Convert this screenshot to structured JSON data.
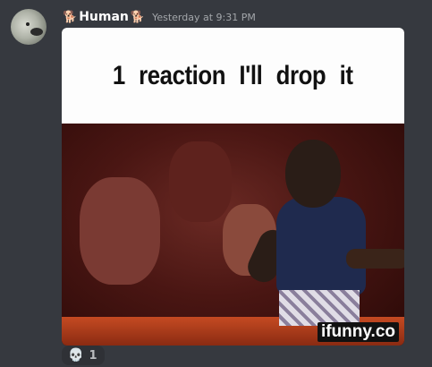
{
  "message": {
    "author": {
      "name": "Human",
      "name_prefix_emoji": "🐕",
      "name_suffix_emoji": "🐕",
      "avatar_icon": "sea-lion-avatar"
    },
    "timestamp": "Yesterday at 9:31 PM",
    "attachment": {
      "caption": "1 reaction I'll drop it",
      "watermark": "ifunny.co"
    },
    "reactions": [
      {
        "emoji": "💀",
        "icon": "skull-icon",
        "count": "1"
      }
    ]
  },
  "colors": {
    "background": "#36393f",
    "username": "#ffffff",
    "timestamp": "#a3a6aa",
    "reaction_bg": "#2f3136"
  }
}
